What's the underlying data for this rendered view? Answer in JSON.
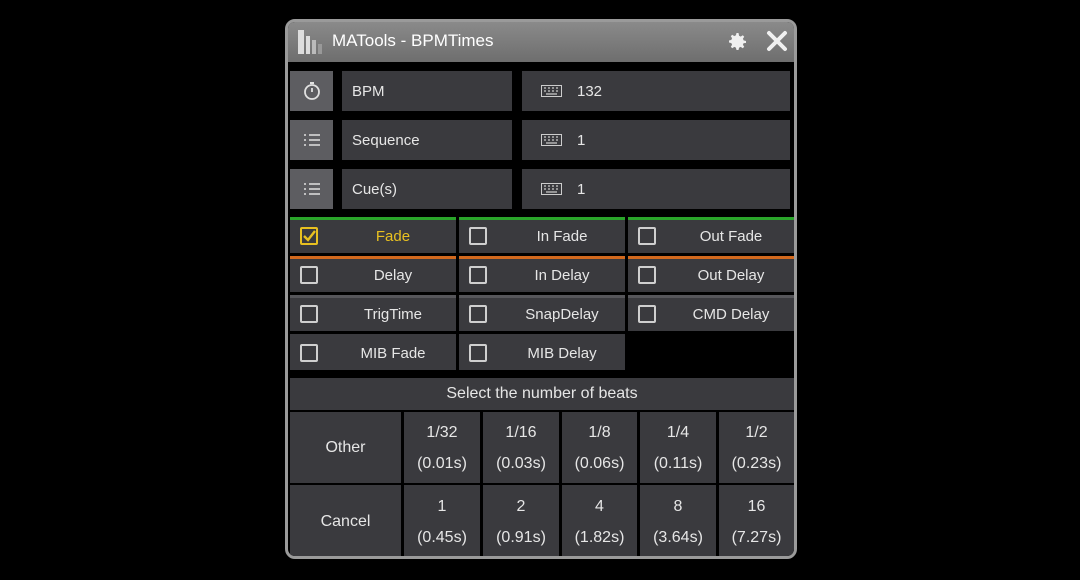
{
  "window": {
    "title": "MATools - BPMTimes",
    "logo_icon": "matools-logo-icon",
    "settings_icon": "gear-icon",
    "close_icon": "close-icon"
  },
  "fields": [
    {
      "icon": "stopwatch-icon",
      "label": "BPM",
      "value": "132"
    },
    {
      "icon": "list-icon",
      "label": "Sequence",
      "value": "1"
    },
    {
      "icon": "list-icon",
      "label": "Cue(s)",
      "value": "1"
    }
  ],
  "options": [
    {
      "label": "Fade",
      "checked": true
    },
    {
      "label": "In Fade",
      "checked": false
    },
    {
      "label": "Out Fade",
      "checked": false
    },
    {
      "label": "Delay",
      "checked": false
    },
    {
      "label": "In Delay",
      "checked": false
    },
    {
      "label": "Out Delay",
      "checked": false
    },
    {
      "label": "TrigTime",
      "checked": false
    },
    {
      "label": "SnapDelay",
      "checked": false
    },
    {
      "label": "CMD Delay",
      "checked": false
    },
    {
      "label": "MIB Fade",
      "checked": false
    },
    {
      "label": "MIB Delay",
      "checked": false
    }
  ],
  "beats": {
    "header": "Select the number of beats",
    "other_label": "Other",
    "cancel_label": "Cancel",
    "row1": [
      {
        "beat": "1/32",
        "time": "(0.01s)"
      },
      {
        "beat": "1/16",
        "time": "(0.03s)"
      },
      {
        "beat": "1/8",
        "time": "(0.06s)"
      },
      {
        "beat": "1/4",
        "time": "(0.11s)"
      },
      {
        "beat": "1/2",
        "time": "(0.23s)"
      }
    ],
    "row2": [
      {
        "beat": "1",
        "time": "(0.45s)"
      },
      {
        "beat": "2",
        "time": "(0.91s)"
      },
      {
        "beat": "4",
        "time": "(1.82s)"
      },
      {
        "beat": "8",
        "time": "(3.64s)"
      },
      {
        "beat": "16",
        "time": "(7.27s)"
      }
    ]
  },
  "colors": {
    "accent_checked": "#e8c020",
    "fade_row_bar": "#2aa52a",
    "delay_row_bar": "#d2691e"
  }
}
